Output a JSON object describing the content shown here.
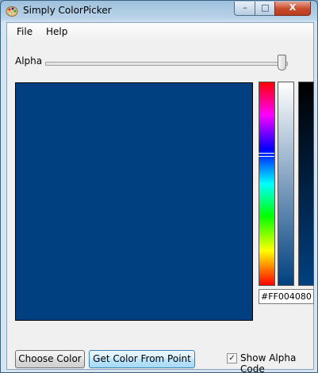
{
  "window": {
    "title": "Simply ColorPicker"
  },
  "titlebar_buttons": {
    "minimize": "–",
    "maximize": "□",
    "close": "X"
  },
  "menu": {
    "file": "File",
    "help": "Help"
  },
  "alpha": {
    "label": "Alpha",
    "level": 1.0
  },
  "color": {
    "hex": "#FF004080",
    "preview": "#004080"
  },
  "buttons": {
    "choose_color": "Choose Color",
    "get_color_from_point": "Get Color From Point"
  },
  "show_alpha": {
    "label": "Show Alpha Code",
    "checked": true,
    "mark": "✓"
  }
}
